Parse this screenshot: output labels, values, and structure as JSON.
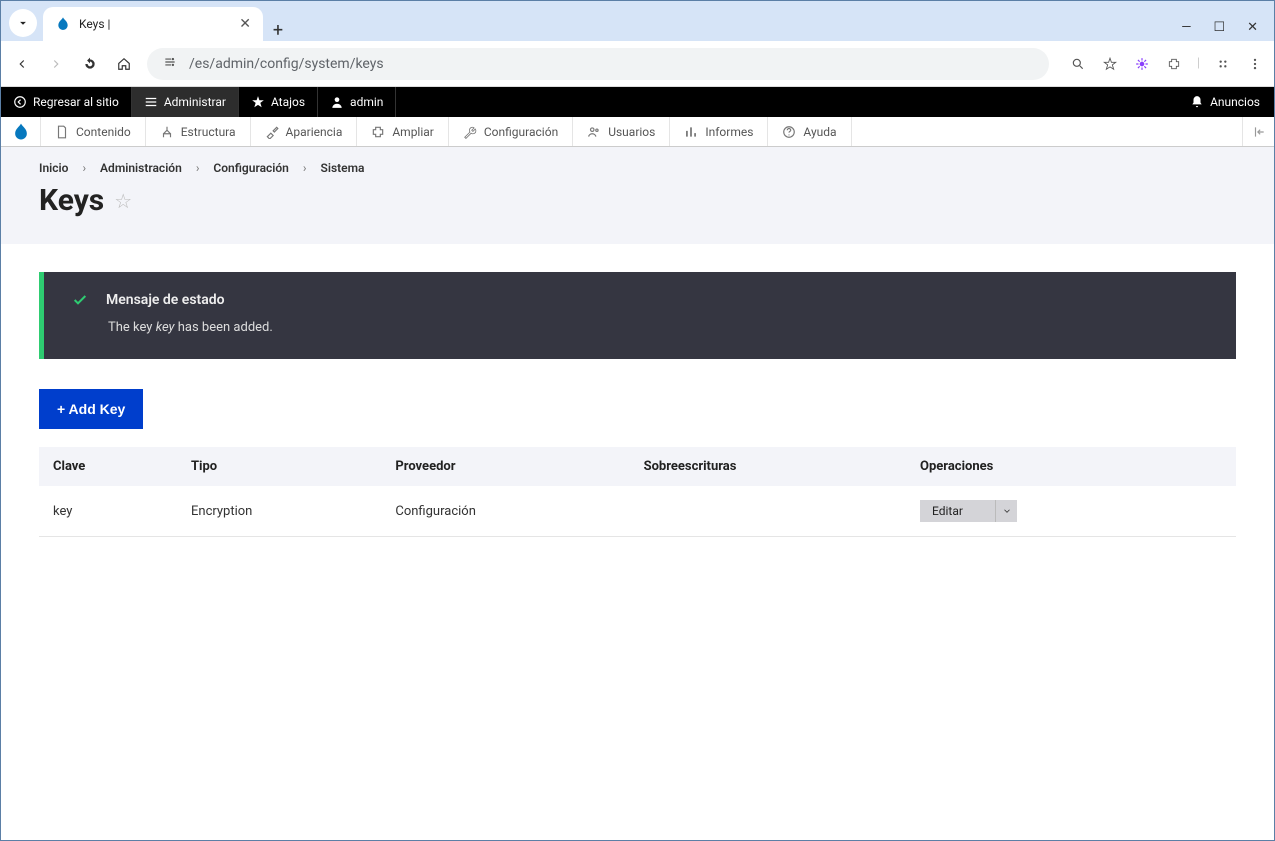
{
  "browser": {
    "tab_title": "Keys |",
    "url": "/es/admin/config/system/keys"
  },
  "toolbar": {
    "back_to_site": "Regresar al sitio",
    "manage": "Administrar",
    "shortcuts": "Atajos",
    "user": "admin",
    "announcements": "Anuncios"
  },
  "admin_menu": {
    "content": "Contenido",
    "structure": "Estructura",
    "appearance": "Apariencia",
    "extend": "Ampliar",
    "configuration": "Configuración",
    "people": "Usuarios",
    "reports": "Informes",
    "help": "Ayuda"
  },
  "breadcrumb": [
    "Inicio",
    "Administración",
    "Configuración",
    "Sistema"
  ],
  "page_title": "Keys",
  "status": {
    "heading": "Mensaje de estado",
    "prefix": "The key ",
    "key_name": "key",
    "suffix": " has been added."
  },
  "actions": {
    "add_key": "+ Add Key"
  },
  "table": {
    "headers": {
      "key": "Clave",
      "type": "Tipo",
      "provider": "Proveedor",
      "overrides": "Sobreescrituras",
      "operations": "Operaciones"
    },
    "rows": [
      {
        "key": "key",
        "type": "Encryption",
        "provider": "Configuración",
        "overrides": "",
        "op": "Editar"
      }
    ]
  }
}
